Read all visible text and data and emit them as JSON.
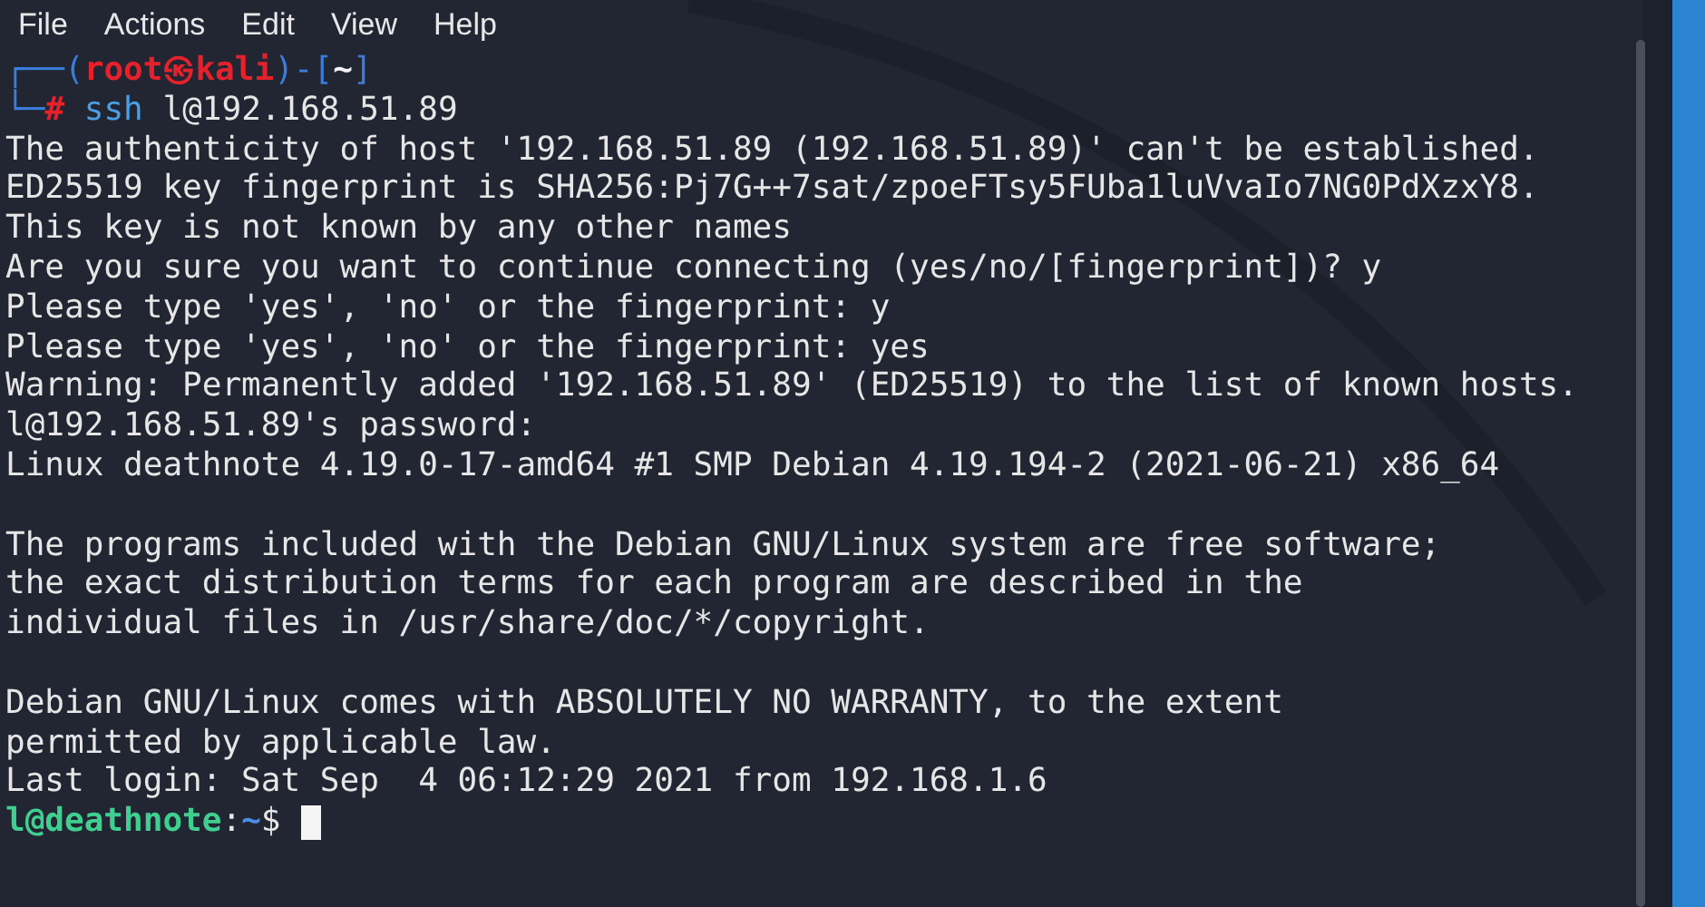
{
  "menu": [
    "File",
    "Actions",
    "Edit",
    "View",
    "Help"
  ],
  "terminal": {
    "lines": [
      {
        "kind": "prompt",
        "segments": [
          {
            "kind": "frame",
            "text": "┌──("
          },
          {
            "kind": "user",
            "text": "root㉿kali"
          },
          {
            "kind": "frame",
            "text": ")-["
          },
          {
            "kind": "path",
            "text": "~"
          },
          {
            "kind": "frame",
            "text": "]"
          }
        ]
      },
      {
        "kind": "prompt",
        "segments": [
          {
            "kind": "frame",
            "text": "└─"
          },
          {
            "kind": "user",
            "text": "#"
          },
          {
            "kind": "command",
            "text": " ssh"
          },
          {
            "kind": "plain",
            "text": " l@192.168.51.89"
          }
        ]
      },
      {
        "kind": "output",
        "text": "The authenticity of host '192.168.51.89 (192.168.51.89)' can't be established."
      },
      {
        "kind": "output",
        "text": "ED25519 key fingerprint is SHA256:Pj7G++7sat/zpoeFTsy5FUba1luVvaIo7NG0PdXzxY8."
      },
      {
        "kind": "output",
        "text": "This key is not known by any other names"
      },
      {
        "kind": "output",
        "text": "Are you sure you want to continue connecting (yes/no/[fingerprint])? y"
      },
      {
        "kind": "output",
        "text": "Please type 'yes', 'no' or the fingerprint: y"
      },
      {
        "kind": "output",
        "text": "Please type 'yes', 'no' or the fingerprint: yes"
      },
      {
        "kind": "output",
        "text": "Warning: Permanently added '192.168.51.89' (ED25519) to the list of known hosts."
      },
      {
        "kind": "output",
        "text": "l@192.168.51.89's password:"
      },
      {
        "kind": "output",
        "text": "Linux deathnote 4.19.0-17-amd64 #1 SMP Debian 4.19.194-2 (2021-06-21) x86_64"
      },
      {
        "kind": "blank"
      },
      {
        "kind": "output",
        "text": "The programs included with the Debian GNU/Linux system are free software;"
      },
      {
        "kind": "output",
        "text": "the exact distribution terms for each program are described in the"
      },
      {
        "kind": "output",
        "text": "individual files in /usr/share/doc/*/copyright."
      },
      {
        "kind": "blank"
      },
      {
        "kind": "output",
        "text": "Debian GNU/Linux comes with ABSOLUTELY NO WARRANTY, to the extent"
      },
      {
        "kind": "output",
        "text": "permitted by applicable law."
      },
      {
        "kind": "output",
        "text": "Last login: Sat Sep  4 06:12:29 2021 from 192.168.1.6"
      },
      {
        "kind": "prompt",
        "segments": [
          {
            "kind": "host",
            "text": "l@deathnote"
          },
          {
            "kind": "plain",
            "text": ":"
          },
          {
            "kind": "dir",
            "text": "~"
          },
          {
            "kind": "plain",
            "text": "$ "
          }
        ],
        "cursor": true
      }
    ]
  }
}
